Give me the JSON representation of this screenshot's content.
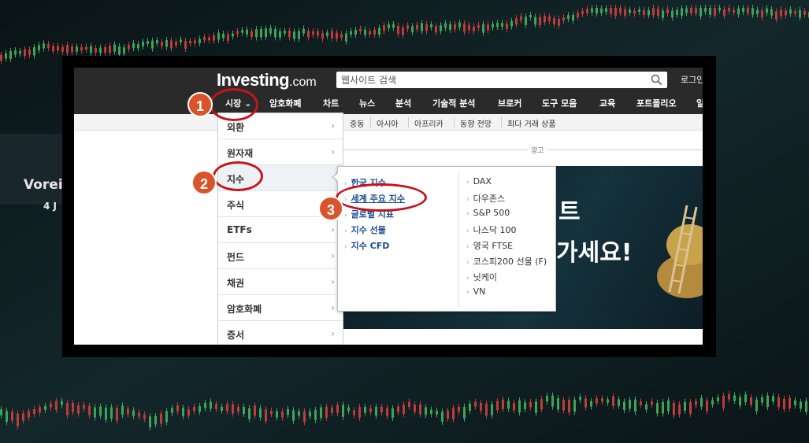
{
  "header": {
    "logo": "Investing",
    "logo_suffix": ".com",
    "search_placeholder": "웹사이트 검색",
    "login_label": "로그인"
  },
  "nav": [
    {
      "label": "시장 ⌄"
    },
    {
      "label": "암호화폐"
    },
    {
      "label": "차트"
    },
    {
      "label": "뉴스"
    },
    {
      "label": "분석"
    },
    {
      "label": "기술적 분석"
    },
    {
      "label": "브로커"
    },
    {
      "label": "도구 모음"
    },
    {
      "label": "교육"
    },
    {
      "label": "포트폴리오"
    },
    {
      "label": "일"
    }
  ],
  "subnav": [
    "중동",
    "아시아",
    "아프리카",
    "동향 전망",
    "최다 거래 상품"
  ],
  "ad_label": "광고",
  "banner": {
    "line1": "트",
    "line2": "가세요!"
  },
  "dropdown": [
    {
      "label": "외환"
    },
    {
      "label": "원자재"
    },
    {
      "label": "지수"
    },
    {
      "label": "주식"
    },
    {
      "label": "ETFs"
    },
    {
      "label": "펀드"
    },
    {
      "label": "채권"
    },
    {
      "label": "암호화폐"
    },
    {
      "label": "증서"
    }
  ],
  "chevron": "›",
  "submenu": {
    "left": [
      "한국 지수",
      "세계 주요 지수",
      "글로벌 지표",
      "지수 선물",
      "지수 CFD"
    ],
    "right": [
      "DAX",
      "다우존스",
      "S&P 500",
      "나스닥 100",
      "영국 FTSE",
      "코스피200 선물 (F)",
      "닛케이",
      "VN"
    ],
    "bullet": "›"
  },
  "annotations": {
    "step1": "1",
    "step2": "2",
    "step3": "3"
  },
  "colors": {
    "annotation_ring": "#c4151c",
    "badge": "#d9542a",
    "header": "#2a2a2a",
    "link": "#1a4c8e"
  }
}
